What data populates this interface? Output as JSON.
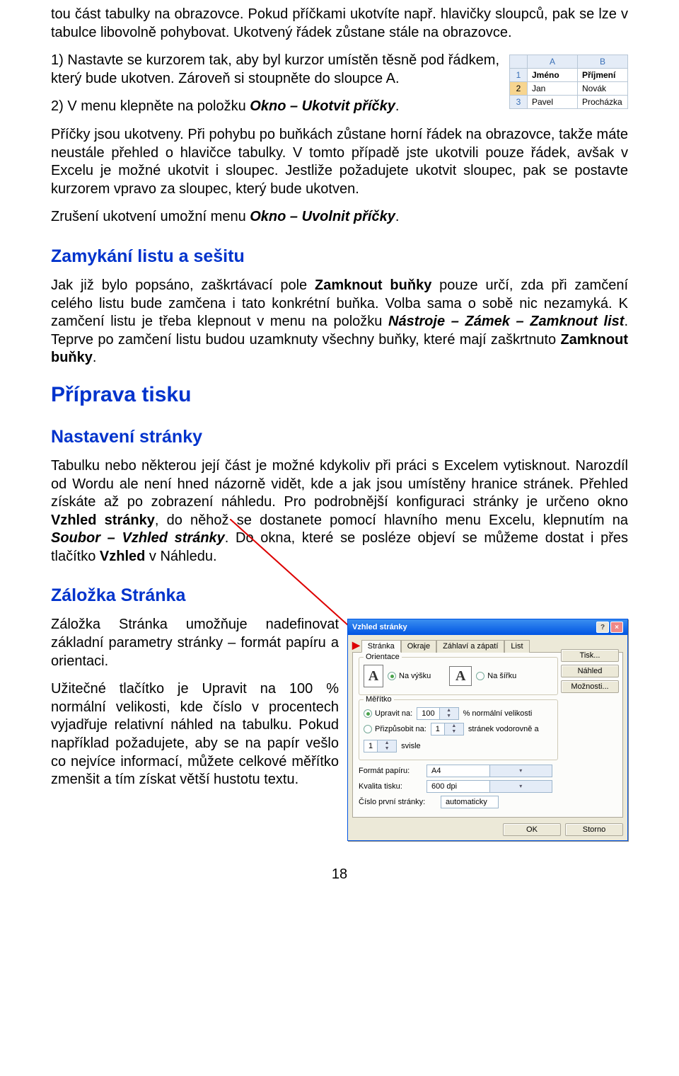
{
  "intro_para": "tou část tabulky na obrazovce. Pokud příčkami ukotvíte např. hlavičky sloupců, pak se lze v tabulce libovolně pohybovat. Ukotvený řádek zůstane stále na obrazovce.",
  "step1_a": "1) Nastavte se kurzorem tak, aby byl kurzor umístěn těsně pod řádkem, který bude ukotven. Zároveň si stoupněte do sloupce A.",
  "step2_a": "2) V menu klepněte na položku ",
  "step2_b": "Okno – Ukotvit příčky",
  "step2_c": ".",
  "para2": "Příčky jsou ukotveny. Při pohybu po buňkách zůstane horní řádek na obrazovce, takže máte neustále přehled o hlavičce tabulky. V tomto případě jste ukotvili pouze řádek, avšak v Excelu je možné ukotvit i sloupec. Jestliže požadujete ukotvit sloupec, pak se postavte kurzorem vpravo za sloupec, který bude ukotven.",
  "para3_a": "Zrušení ukotvení umožní menu ",
  "para3_b": "Okno – Uvolnit příčky",
  "para3_c": ".",
  "h_lock": "Zamykání listu a sešitu",
  "para4_a": "Jak již bylo popsáno, zaškrtávací pole ",
  "para4_b": "Zamknout buňky",
  "para4_c": " pouze určí, zda při zamčení celého listu bude zamčena i tato konkrétní buňka. Volba sama o sobě nic nezamyká. K zamčení listu je třeba klepnout v menu na položku ",
  "para4_d": "Nástroje – Zámek – Zamknout list",
  "para4_e": ". Teprve po zamčení listu budou uzamknuty všechny buňky, které mají zaškrtnuto ",
  "para4_f": "Zamknout buňky",
  "para4_g": ".",
  "h_print": "Příprava tisku",
  "h_page": "Nastavení stránky",
  "para5_a": "Tabulku nebo některou její část je možné kdykoliv při práci s Excelem vytisknout. Narozdíl od Wordu ale není hned názorně vidět, kde a jak jsou umístěny hranice stránek. Přehled získáte až po zobrazení náhledu. Pro podrobnější konfiguraci stránky je určeno okno ",
  "para5_b": "Vzhled stránky",
  "para5_c": ", do něhož se dostanete pomocí hlavního menu Excelu, klepnutím na ",
  "para5_d": "Soubor – Vzhled stránky",
  "para5_e": ". Do okna, které se posléze objeví se můžeme dostat i přes tlačítko ",
  "para5_f": "Vzhled",
  "para5_g": " v Náhledu.",
  "h_tab": "Záložka Stránka",
  "para6": "Záložka Stránka umožňuje nadefinovat základní parametry stránky – formát papíru a orientaci.",
  "para7": "Užitečné tlačítko je Upravit na 100 % normální velikosti, kde číslo v procentech vyjadřuje relativní náhled na tabulku. Pokud například požadujete, aby se na papír vešlo co nejvíce informací, můžete celkové měřítko zmenšit a tím získat větší hustotu textu.",
  "pagenum": "18",
  "excel": {
    "colA": "A",
    "colB": "B",
    "row1": "1",
    "row2": "2",
    "row3": "3",
    "h1": "Jméno",
    "h2": "Příjmení",
    "r2c1": "Jan",
    "r2c2": "Novák",
    "r3c1": "Pavel",
    "r3c2": "Procházka"
  },
  "dlg": {
    "title": "Vzhled stránky",
    "tab1": "Stránka",
    "tab2": "Okraje",
    "tab3": "Záhlaví a zápatí",
    "tab4": "List",
    "btn_print": "Tisk...",
    "btn_preview": "Náhled",
    "btn_options": "Možnosti...",
    "g_orient": "Orientace",
    "o_port": "Na výšku",
    "o_land": "Na šířku",
    "g_scale": "Měřítko",
    "s_fit": "Upravit na:",
    "s_fit_val": "100",
    "s_fit_sfx": "% normální velikosti",
    "s_adj": "Přizpůsobit na:",
    "s_adj_v1": "1",
    "s_adj_mid": "stránek vodorovně a",
    "s_adj_v2": "1",
    "s_adj_sfx": "svisle",
    "l_paper": "Formát papíru:",
    "v_paper": "A4",
    "l_dpi": "Kvalita tisku:",
    "v_dpi": "600 dpi",
    "l_first": "Číslo první stránky:",
    "v_first": "automaticky",
    "ok": "OK",
    "cancel": "Storno",
    "A": "A"
  }
}
